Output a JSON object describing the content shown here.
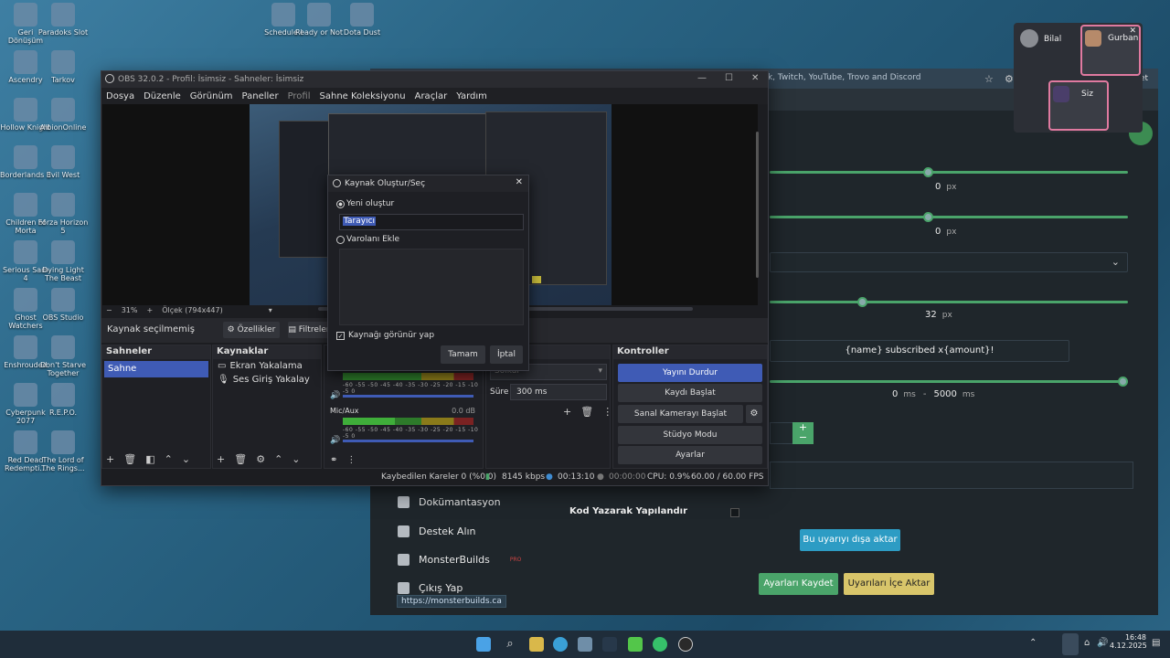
{
  "desktop": {
    "icons": [
      {
        "label": "Geri Dönüşüm",
        "x": 0
      },
      {
        "label": "Paradoks Slot",
        "x": 0
      },
      {
        "label": "Ascendry",
        "x": 0
      },
      {
        "label": "Tarkov",
        "x": 0
      },
      {
        "label": "Hollow Knight",
        "x": 0
      },
      {
        "label": "AlbionOnline",
        "x": 0
      },
      {
        "label": "Borderlands 3",
        "x": 0
      },
      {
        "label": "Evil West",
        "x": 0
      },
      {
        "label": "Children of Morta",
        "x": 0
      },
      {
        "label": "Forza Horizon 5",
        "x": 0
      },
      {
        "label": "Serious Sam 4",
        "x": 0
      },
      {
        "label": "Dying Light The Beast",
        "x": 0
      },
      {
        "label": "Ghost Watchers",
        "x": 0
      },
      {
        "label": "OBS Studio",
        "x": 0
      },
      {
        "label": "Enshrouded",
        "x": 0
      },
      {
        "label": "Don't Starve Together",
        "x": 0
      },
      {
        "label": "Cyberpunk 2077",
        "x": 0
      },
      {
        "label": "R.E.P.O.",
        "x": 0
      },
      {
        "label": "Red Dead Redempti...",
        "x": 0
      },
      {
        "label": "The Lord of The Rings...",
        "x": 0
      }
    ],
    "top_icons": [
      "Schedule I",
      "Ready or Not",
      "Dota Dust"
    ]
  },
  "browser": {
    "banner": "ck, Twitch, YouTube, Trovo and Discord",
    "partial_btn": "et et",
    "value1": "0",
    "unit1": "px",
    "value2": "0",
    "unit2": "px",
    "value3": "32",
    "unit3": "px",
    "message_template": "{name} subscribed x{amount}!",
    "range_min": "0",
    "range_max": "5000",
    "range_unit": "ms",
    "sidebar": {
      "docs": "Dokümantasyon",
      "support": "Destek Alın",
      "monsterbuilds": "MonsterBuilds",
      "monsterbuilds_badge": "PRO",
      "logout": "Çıkış Yap"
    },
    "code_config_label": "Kod Yazarak Yapılandır",
    "export_alert_btn": "Bu uyarıyı dışa aktar",
    "save_btn": "Ayarları Kaydet",
    "import_btn": "Uyarıları İçe Aktar",
    "status_url": "https://monsterbuilds.ca"
  },
  "obs": {
    "title": "OBS 32.0.2 - Profil: İsimsiz - Sahneler: İsimsiz",
    "menu": [
      "Dosya",
      "Düzenle",
      "Görünüm",
      "Paneller",
      "Profil",
      "Sahne Koleksiyonu",
      "Araçlar",
      "Yardım"
    ],
    "zoom": "31%",
    "scale_label": "Ölçek (794x447)",
    "no_source": "Kaynak seçilmemiş",
    "properties_btn": "Özellikler",
    "filters_btn": "Filtreler",
    "scenes_header": "Sahneler",
    "scene_item": "Sahne",
    "sources_header": "Kaynaklar",
    "sources": [
      "Ekran Yakalama",
      "Ses Giriş Yakalay"
    ],
    "mixer_track2": "Mic/Aux",
    "mixer_track2_db": "0.0 dB",
    "mixer_scale": "-60 -55 -50 -45 -40 -35 -30 -25 -20 -15 -10 -5 0",
    "transitions_header": "şleri",
    "transition_value": "Solkul",
    "duration_label": "Süre",
    "duration_value": "300 ms",
    "controls_header": "Kontroller",
    "controls": {
      "stop_stream": "Yayını Durdur",
      "start_record": "Kaydı Başlat",
      "virtual_cam": "Sanal Kamerayı Başlat",
      "studio_mode": "Stüdyo Modu",
      "settings": "Ayarlar"
    },
    "status": {
      "dropped": "Kaybedilen Kareler 0 (%0.0)",
      "bitrate": "8145 kbps",
      "stream_time": "00:13:10",
      "record_time": "00:00:00",
      "cpu": "CPU: 0.9%",
      "fps": "60.00 / 60.00 FPS"
    }
  },
  "dialog": {
    "title": "Kaynak Oluştur/Seç",
    "create_new": "Yeni oluştur",
    "name_value": "Tarayıcı",
    "add_existing": "Varolanı Ekle",
    "make_visible": "Kaynağı görünür yap",
    "ok": "Tamam",
    "cancel": "İptal"
  },
  "call": {
    "participants": [
      "Bilal",
      "Gurban",
      "Siz"
    ]
  },
  "taskbar": {
    "time": "16:48",
    "date": "4.12.2025"
  },
  "colors": {
    "accent_blue": "#3f5bb5",
    "green": "#4aa46a",
    "teal_btn": "#2d9cc4",
    "yellow_btn": "#d8c56a"
  }
}
